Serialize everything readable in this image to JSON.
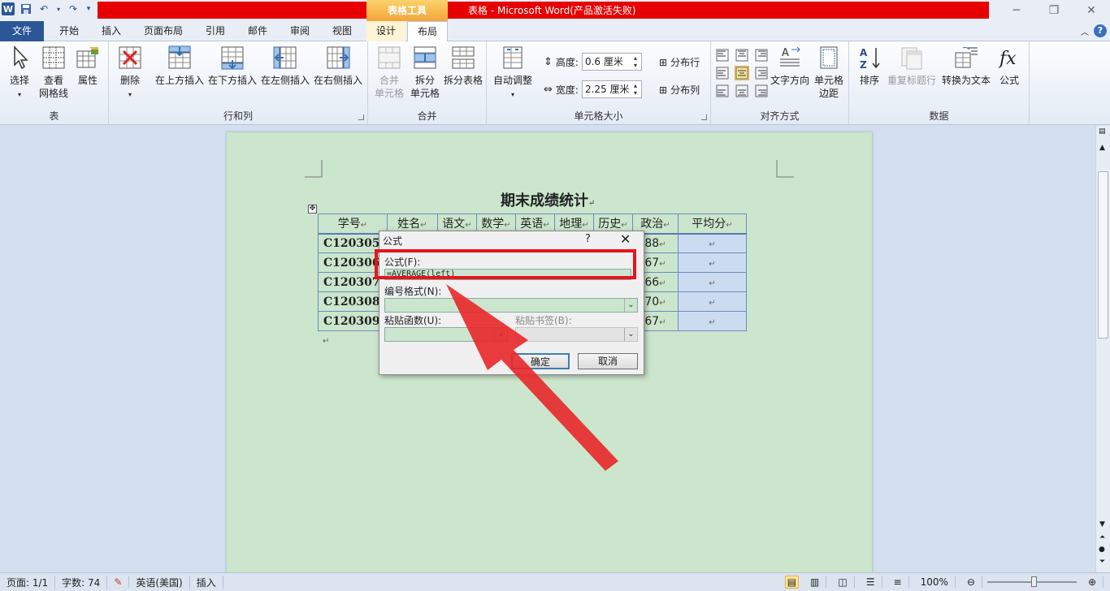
{
  "window": {
    "title": "表格 - Microsoft Word(产品激活失败)",
    "context_tab_group": "表格工具",
    "app_icon": "W",
    "accent_colors": {
      "file_tab": "#2b5797",
      "context": "#f2a53b",
      "red_bar": "#e60000",
      "highlight": "#e8141c"
    }
  },
  "tabs": [
    "文件",
    "开始",
    "插入",
    "页面布局",
    "引用",
    "邮件",
    "审阅",
    "视图",
    "设计",
    "布局"
  ],
  "active_tab": "布局",
  "ribbon": {
    "groups": [
      "表",
      "行和列",
      "合并",
      "单元格大小",
      "对齐方式",
      "数据"
    ],
    "table": {
      "select": "选择",
      "gridlines_1": "查看",
      "gridlines_2": "网格线",
      "properties": "属性"
    },
    "rows_cols": {
      "delete": "删除",
      "insert_above": "在上方插入",
      "insert_below": "在下方插入",
      "insert_left": "在左侧插入",
      "insert_right": "在右侧插入"
    },
    "merge": {
      "merge_1": "合并",
      "merge_2": "单元格",
      "split_1": "拆分",
      "split_2": "单元格",
      "split_table": "拆分表格"
    },
    "cell_size": {
      "autofit": "自动调整",
      "height_label": "高度:",
      "height_value": "0.6 厘米",
      "width_label": "宽度:",
      "width_value": "2.25 厘米",
      "dist_rows": "分布行",
      "dist_cols": "分布列"
    },
    "alignment": {
      "text_direction": "文字方向",
      "margins_1": "单元格",
      "margins_2": "边距"
    },
    "data": {
      "sort": "排序",
      "repeat_header": "重复标题行",
      "convert": "转换为文本",
      "formula": "公式"
    }
  },
  "document": {
    "title": "期末成绩统计",
    "headers": [
      "学号",
      "姓名",
      "语文",
      "数学",
      "英语",
      "地理",
      "历史",
      "政治",
      "平均分"
    ],
    "rows": [
      {
        "id": "C120305",
        "pol": "88"
      },
      {
        "id": "C120306",
        "pol": "67"
      },
      {
        "id": "C120307",
        "pol": "66"
      },
      {
        "id": "C120308",
        "pol": "70"
      },
      {
        "id": "C120309",
        "pol": "67"
      }
    ],
    "para_mark": "↵"
  },
  "dialog": {
    "title": "公式",
    "help": "?",
    "formula_label": "公式(F):",
    "formula_value": "=AVERAGE(left)",
    "number_format_label": "编号格式(N):",
    "paste_function_label": "粘贴函数(U):",
    "paste_bookmark_label": "粘贴书签(B):",
    "ok": "确定",
    "cancel": "取消"
  },
  "statusbar": {
    "page": "页面: 1/1",
    "words": "字数: 74",
    "language": "英语(美国)",
    "mode": "插入",
    "zoom": "100%",
    "zoom_level_percent": 100
  }
}
